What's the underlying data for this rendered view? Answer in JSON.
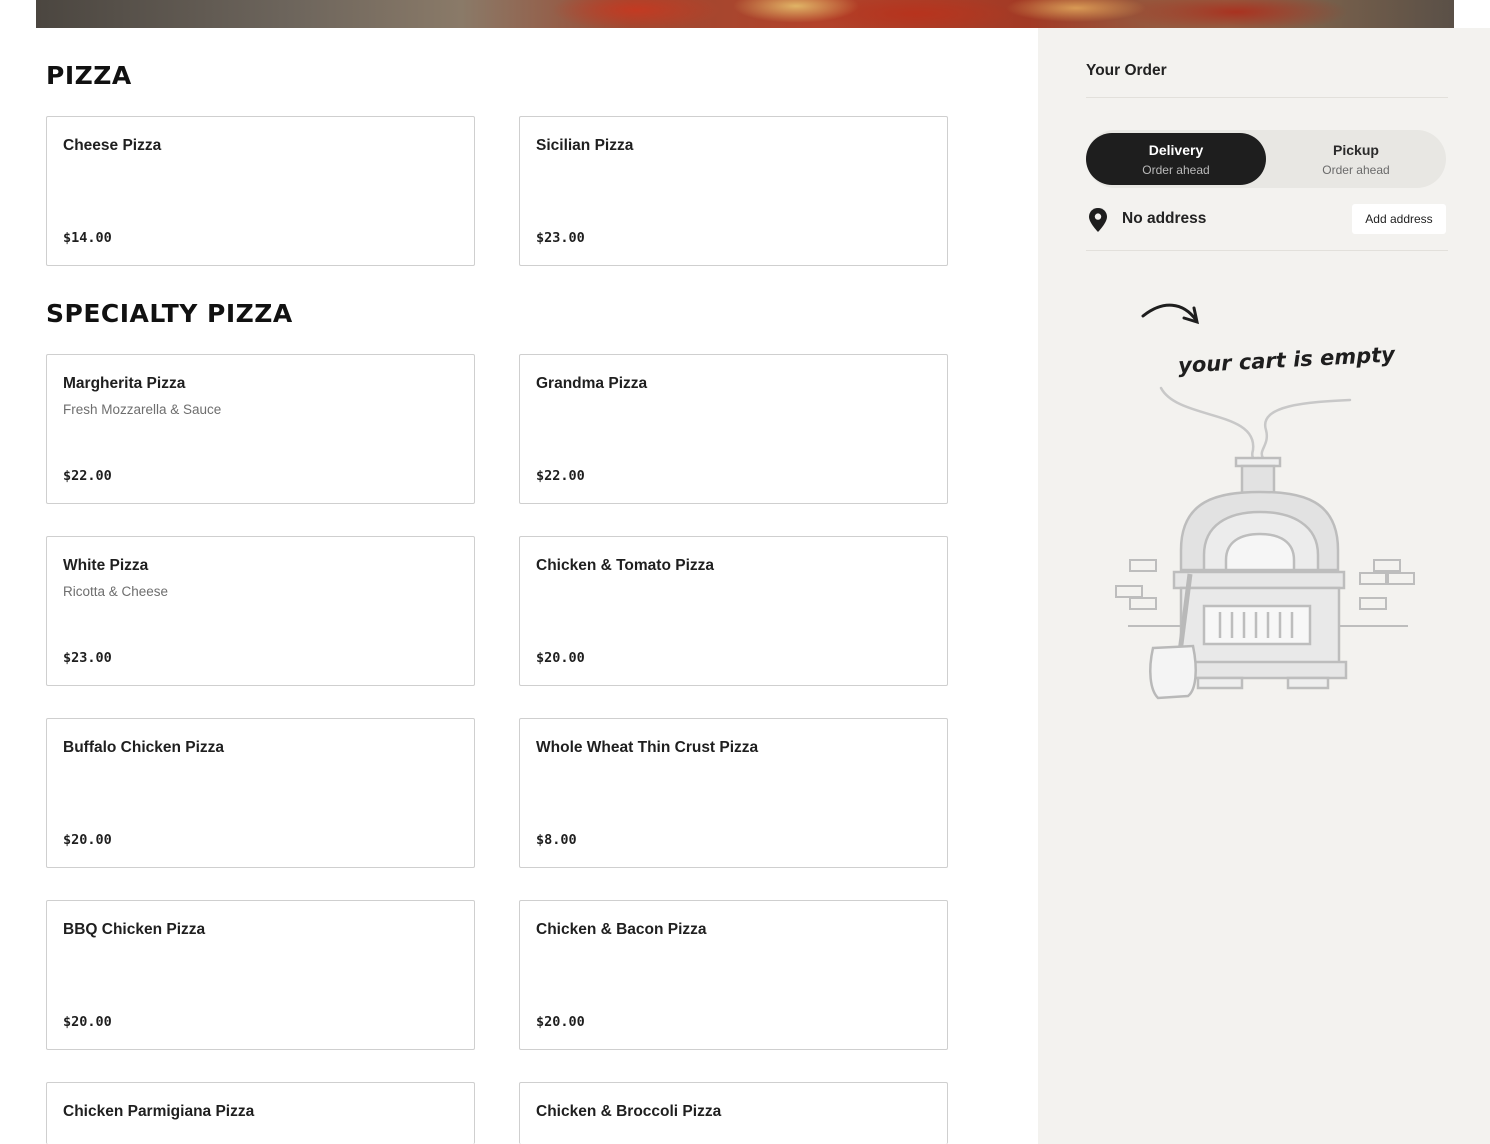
{
  "sections": [
    {
      "title": "PIZZA",
      "items": [
        {
          "name": "Cheese Pizza",
          "description": "",
          "price": "$14.00"
        },
        {
          "name": "Sicilian Pizza",
          "description": "",
          "price": "$23.00"
        }
      ]
    },
    {
      "title": "SPECIALTY PIZZA",
      "items": [
        {
          "name": "Margherita Pizza",
          "description": "Fresh Mozzarella & Sauce",
          "price": "$22.00"
        },
        {
          "name": "Grandma Pizza",
          "description": "",
          "price": "$22.00"
        },
        {
          "name": "White Pizza",
          "description": "Ricotta & Cheese",
          "price": "$23.00"
        },
        {
          "name": "Chicken & Tomato Pizza",
          "description": "",
          "price": "$20.00"
        },
        {
          "name": "Buffalo Chicken Pizza",
          "description": "",
          "price": "$20.00"
        },
        {
          "name": "Whole Wheat Thin Crust Pizza",
          "description": "",
          "price": "$8.00"
        },
        {
          "name": "BBQ Chicken Pizza",
          "description": "",
          "price": "$20.00"
        },
        {
          "name": "Chicken & Bacon Pizza",
          "description": "",
          "price": "$20.00"
        },
        {
          "name": "Chicken Parmigiana Pizza",
          "description": "",
          "price": ""
        },
        {
          "name": "Chicken & Broccoli Pizza",
          "description": "",
          "price": ""
        }
      ]
    }
  ],
  "order": {
    "title": "Your Order",
    "modes": [
      {
        "label": "Delivery",
        "sublabel": "Order ahead",
        "selected": true
      },
      {
        "label": "Pickup",
        "sublabel": "Order ahead",
        "selected": false
      }
    ],
    "address_text": "No address",
    "add_address_label": "Add address",
    "empty_cart_text": "your cart is empty",
    "icons": {
      "location": "map-pin-icon",
      "arrow": "curved-arrow-icon",
      "illustration": "pizza-oven-illustration"
    }
  },
  "colors": {
    "sidebar_bg": "#f3f2ef",
    "toggle_active": "#1e1e1e",
    "card_border": "#cfcfcf"
  }
}
